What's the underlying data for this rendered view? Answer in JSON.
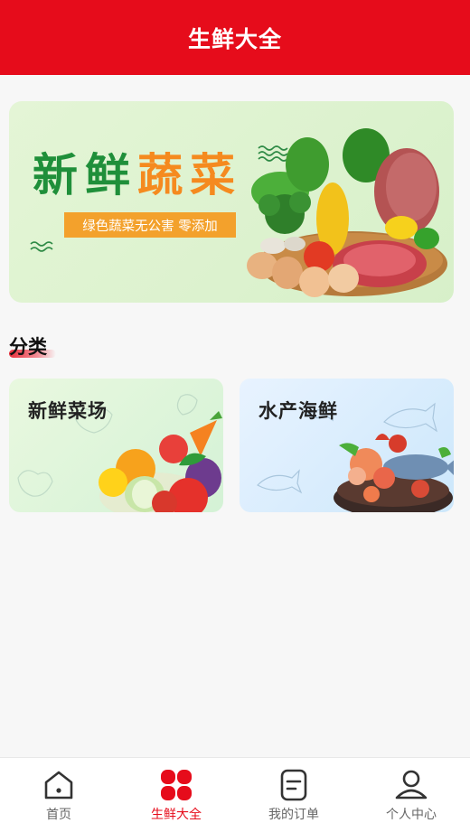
{
  "header": {
    "title": "生鲜大全"
  },
  "banner": {
    "headline_part1": "新鲜",
    "headline_part2": "蔬菜",
    "tagline": "绿色蔬菜无公害 零添加"
  },
  "section": {
    "title": "分类"
  },
  "categories": [
    {
      "label": "新鲜菜场",
      "icon": "vegetables-illustration"
    },
    {
      "label": "水产海鲜",
      "icon": "seafood-illustration"
    }
  ],
  "tabbar": {
    "active_color": "#e60c1b",
    "items": [
      {
        "label": "首页",
        "icon": "home-icon"
      },
      {
        "label": "生鲜大全",
        "icon": "category-icon",
        "active": true
      },
      {
        "label": "我的订单",
        "icon": "orders-icon"
      },
      {
        "label": "个人中心",
        "icon": "user-icon"
      }
    ]
  },
  "colors": {
    "brand": "#e60c1b",
    "headline_green": "#1f8f3a",
    "headline_orange": "#f58a1f"
  }
}
